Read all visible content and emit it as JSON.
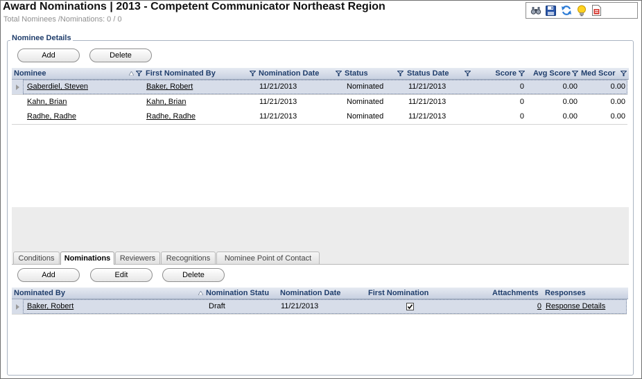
{
  "page": {
    "title": "Award Nominations | 2013 - Competent Communicator Northeast Region",
    "subtitle": "Total Nominees /Nominations: 0 / 0"
  },
  "toolbar": [
    {
      "icon": "binoculars-icon"
    },
    {
      "icon": "save-disk-icon"
    },
    {
      "icon": "refresh-icon"
    },
    {
      "icon": "lightbulb-icon"
    },
    {
      "icon": "report-icon"
    }
  ],
  "nominee_details": {
    "legend": "Nominee Details",
    "add_label": "Add",
    "delete_label": "Delete",
    "columns": {
      "nominee": "Nominee",
      "first_nominated_by": "First Nominated By",
      "nomination_date": "Nomination Date",
      "status": "Status",
      "status_date": "Status Date",
      "score": "Score",
      "avg_score": "Avg Score",
      "med_score": "Med Scor"
    },
    "rows": [
      {
        "nominee": "Gaberdiel, Steven",
        "first_nominated_by": "Baker, Robert",
        "nomination_date": "11/21/2013",
        "status": "Nominated",
        "status_date": "11/21/2013",
        "score": "0",
        "avg_score": "0.00",
        "med_score": "0.00"
      },
      {
        "nominee": "Kahn, Brian",
        "first_nominated_by": "Kahn, Brian",
        "nomination_date": "11/21/2013",
        "status": "Nominated",
        "status_date": "11/21/2013",
        "score": "0",
        "avg_score": "0.00",
        "med_score": "0.00"
      },
      {
        "nominee": "Radhe, Radhe",
        "first_nominated_by": "Radhe, Radhe",
        "nomination_date": "11/21/2013",
        "status": "Nominated",
        "status_date": "11/21/2013",
        "score": "0",
        "avg_score": "0.00",
        "med_score": "0.00"
      }
    ]
  },
  "tabs": [
    {
      "label": "Conditions"
    },
    {
      "label": "Nominations",
      "active": true
    },
    {
      "label": "Reviewers"
    },
    {
      "label": "Recognitions"
    },
    {
      "label": "Nominee Point of Contact"
    }
  ],
  "nominations": {
    "add_label": "Add",
    "edit_label": "Edit",
    "delete_label": "Delete",
    "columns": {
      "nominated_by": "Nominated By",
      "nomination_status": "Nomination Statu",
      "nomination_date": "Nomination Date",
      "first_nomination": "First Nomination",
      "attachments": "Attachments",
      "responses": "Responses"
    },
    "rows": [
      {
        "nominated_by": "Baker, Robert",
        "nomination_status": "Draft",
        "nomination_date": "11/21/2013",
        "first_nomination": true,
        "attachments": "0",
        "responses": "Response Details"
      }
    ]
  },
  "colors": {
    "header_text": "#1f3d6b",
    "selected_row": "#d7dde9"
  }
}
